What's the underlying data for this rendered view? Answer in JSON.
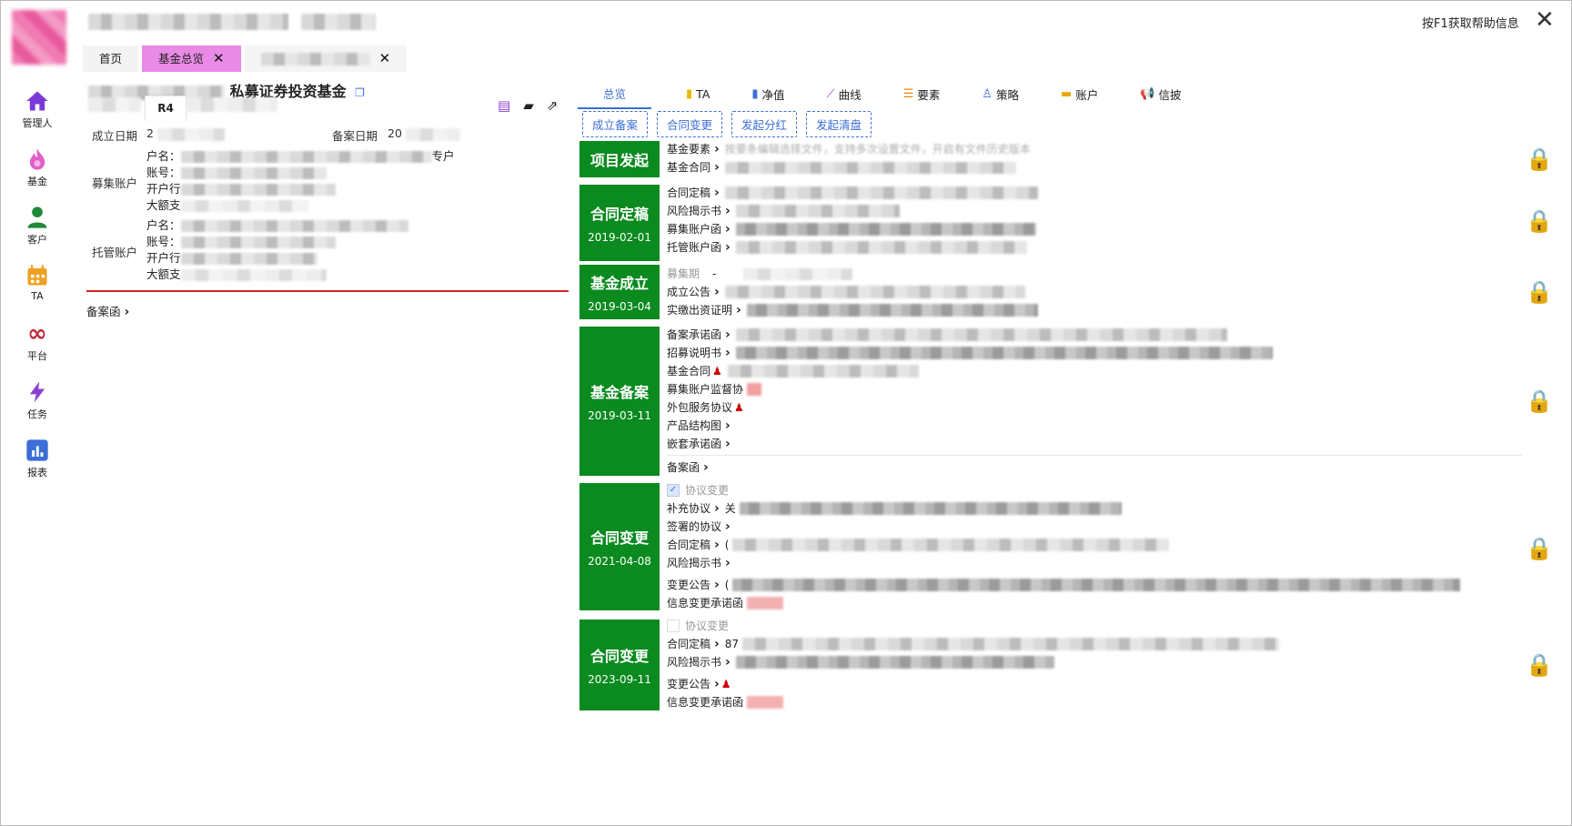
{
  "header": {
    "help_text": "按F1获取帮助信息",
    "close_label": "✕"
  },
  "tabs": [
    {
      "label": "首页",
      "closable": false
    },
    {
      "label": "基金总览",
      "closable": true
    },
    {
      "label": "",
      "closable": true
    }
  ],
  "sidebar": {
    "items": [
      {
        "label": "管理人",
        "icon": "home-icon"
      },
      {
        "label": "基金",
        "icon": "flame-icon"
      },
      {
        "label": "客户",
        "icon": "user-icon"
      },
      {
        "label": "TA",
        "icon": "calendar-icon"
      },
      {
        "label": "平台",
        "icon": "infinity-icon"
      },
      {
        "label": "任务",
        "icon": "lightning-icon"
      },
      {
        "label": "报表",
        "icon": "bar-chart-icon"
      }
    ]
  },
  "fund": {
    "title_suffix": "私募证券投资基金",
    "tag": "R4",
    "establish_label": "成立日期",
    "establish_value": "2",
    "record_label": "备案日期",
    "record_value": "20",
    "raise_account_label": "募集账户",
    "custody_account_label": "托管账户",
    "account_lines": [
      "户名：",
      "账号：",
      "开户行",
      "大额支"
    ],
    "raise_suffix": "专户",
    "beian_left": "备案函"
  },
  "right_tabs": [
    {
      "label": "总览",
      "icon": ""
    },
    {
      "label": "TA",
      "icon": "ta-icon"
    },
    {
      "label": "净值",
      "icon": "bar-icon"
    },
    {
      "label": "曲线",
      "icon": "line-icon"
    },
    {
      "label": "要素",
      "icon": "list-icon"
    },
    {
      "label": "策略",
      "icon": "strategy-icon"
    },
    {
      "label": "账户",
      "icon": "wallet-icon"
    },
    {
      "label": "信披",
      "icon": "megaphone-icon"
    }
  ],
  "action_buttons": [
    "成立备案",
    "合同变更",
    "发起分红",
    "发起清盘"
  ],
  "stages": [
    {
      "title": "项目发起",
      "date": "",
      "items": [
        {
          "name": "基金要素",
          "text": "按要条编辑选择文件，支持多次设置文件，开启有文件历史版本"
        },
        {
          "name": "基金合同",
          "text": ""
        }
      ]
    },
    {
      "title": "合同定稿",
      "date": "2019-02-01",
      "items": [
        {
          "name": "合同定稿",
          "text": ""
        },
        {
          "name": "风险揭示书",
          "text": ""
        },
        {
          "name": "募集账户函",
          "text": ""
        },
        {
          "name": "托管账户函",
          "text": ""
        }
      ]
    },
    {
      "title": "基金成立",
      "date": "2019-03-04",
      "items": [
        {
          "name": "募集期",
          "text": "-"
        },
        {
          "name": "成立公告",
          "text": ""
        },
        {
          "name": "实缴出资证明",
          "text": ""
        }
      ]
    },
    {
      "title": "基金备案",
      "date": "2019-03-11",
      "items": [
        {
          "name": "备案承诺函",
          "text": ""
        },
        {
          "name": "招募说明书",
          "text": ""
        },
        {
          "name": "基金合同",
          "text": ""
        },
        {
          "name": "募集账户监督协",
          "text": ""
        },
        {
          "name": "外包服务协议",
          "text": ""
        },
        {
          "name": "产品结构图",
          "text": ""
        },
        {
          "name": "嵌套承诺函",
          "text": ""
        },
        {
          "name": "备案函",
          "text": ""
        }
      ]
    },
    {
      "title": "合同变更",
      "date": "2021-04-08",
      "items": [
        {
          "name": "协议变更",
          "text": ""
        },
        {
          "name": "补充协议",
          "text": "关"
        },
        {
          "name": "签署的协议",
          "text": ""
        },
        {
          "name": "合同定稿",
          "text": "("
        },
        {
          "name": "风险揭示书",
          "text": ""
        },
        {
          "name": "变更公告",
          "text": "("
        },
        {
          "name": "信息变更承诺函",
          "text": ""
        }
      ]
    },
    {
      "title": "合同变更",
      "date": "2023-09-11",
      "items": [
        {
          "name": "协议变更",
          "text": ""
        },
        {
          "name": "合同定稿",
          "text": "87"
        },
        {
          "name": "风险揭示书",
          "text": ""
        },
        {
          "name": "变更公告",
          "text": ""
        },
        {
          "name": "信息变更承诺函",
          "text": ""
        }
      ]
    }
  ],
  "colors": {
    "stage_green": "#0a8a1f",
    "accent_blue": "#3b6ed6",
    "tab_pink": "#e98ae6",
    "divider_red": "#d22"
  }
}
